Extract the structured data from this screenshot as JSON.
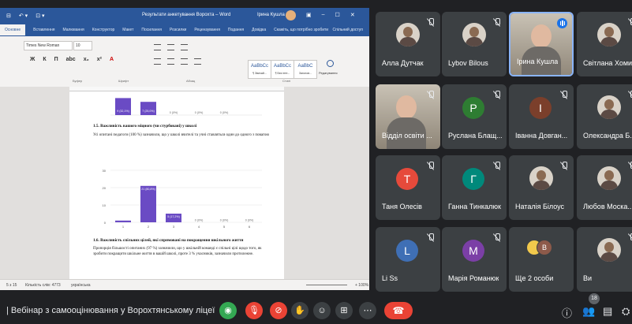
{
  "word": {
    "quick_access": [
      "⊟",
      "↶ ▾",
      "⊡ ▾"
    ],
    "doc_title": "Результати анкетування Ворохта – Word",
    "user_name": "Ірина Кушла",
    "window_controls": [
      "▣",
      "–",
      "☐",
      "✕"
    ],
    "tabs": [
      "Основне",
      "Вставлення",
      "Малювання",
      "Конструктор",
      "Макет",
      "Посилання",
      "Розсилки",
      "Рецензування",
      "Подання",
      "Довідка"
    ],
    "tell_me": "Скажіть, що потрібно зробити",
    "share_label": "Спільний доступ",
    "font_name": "Times New Roman",
    "font_size": "10",
    "format_buttons": [
      "Ж",
      "К",
      "П",
      "abc",
      "x₂",
      "x²",
      "A"
    ],
    "style_samples": [
      "AaBbCc",
      "AaBbCc",
      "AaBbC"
    ],
    "style_names": [
      "¶ Звичай...",
      "¶ Без інте...",
      "Заголов..."
    ],
    "edit_label": "Редагування",
    "groups": [
      "Буфер",
      "Шрифт",
      "Абзац",
      "Стилі"
    ],
    "section_heading": "1.5. Важливість вашого міцного (чи стурбовані) у школі",
    "paragraph1": "Усі опитані педагоги (100 %) зазначили, що у школі вчителі та учні ставляться один до одного з повагою",
    "heading2": "1.6. Важливість спільних цілей, які спрямовані на покращення шкільного життя",
    "paragraph2": "Пропорція більшості опитаних (97 %) зазначили, що у шкільній команді є спільні цілі щодо того, як зробити покращити шкільне життя в вашій школі, проте 3 % учасників, зазначили протилежне.",
    "top_bar_labels": [
      "9 (32,1%)",
      "7 (25,0%)",
      "0 (0%)",
      "0 (0%)",
      "0 (0%)"
    ],
    "y_ticks": [
      "30",
      "20",
      "10",
      "0"
    ],
    "chart_bar_labels": [
      "1 (3,4%)",
      "21 (80,8%)",
      "5 (17,2%)",
      "0 (0%)",
      "0 (0%)",
      "0 (0%)"
    ],
    "x_ticks": [
      "1",
      "2",
      "3",
      "4",
      "5",
      "6"
    ],
    "status": {
      "page": "5 з 15",
      "words": "Кількість слів: 4773",
      "lang": "українська",
      "zoom": "+ 100%"
    }
  },
  "chart_data": {
    "type": "bar",
    "categories": [
      "1",
      "2",
      "3",
      "4",
      "5",
      "6"
    ],
    "values": [
      1,
      21,
      5,
      0,
      0,
      0
    ],
    "data_labels": [
      "1 (3,4%)",
      "21 (80,8%)",
      "5 (17,2%)",
      "0 (0%)",
      "0 (0%)",
      "0 (0%)"
    ],
    "ylim": [
      0,
      30
    ],
    "y_ticks": [
      0,
      10,
      20,
      30
    ],
    "bar_color": "#6a4bc4",
    "grid": true
  },
  "partial_chart": {
    "values": [
      9,
      7,
      0,
      0,
      0
    ]
  },
  "participants": [
    {
      "name": "Алла Дутчак",
      "kind": "photo",
      "muted": true
    },
    {
      "name": "Lybov Bilous",
      "kind": "photo",
      "muted": true
    },
    {
      "name": "Ірина Кушла",
      "kind": "video",
      "muted": false
    },
    {
      "name": "Світлана Хомин",
      "kind": "photo",
      "muted": true
    },
    {
      "name": "Відділ освіти ...",
      "kind": "video",
      "muted": true
    },
    {
      "name": "Руслана Блащ...",
      "kind": "letter",
      "letter": "Р",
      "color": "#2e7d32",
      "muted": true
    },
    {
      "name": "Іванна Довган...",
      "kind": "letter",
      "letter": "І",
      "color": "#7b3f2b",
      "muted": true
    },
    {
      "name": "Олександра Б...",
      "kind": "photo",
      "muted": true
    },
    {
      "name": "Таня Олесів",
      "kind": "letter",
      "letter": "Т",
      "color": "#e64a3b",
      "muted": true
    },
    {
      "name": "Ганна Тинкалюк",
      "kind": "letter",
      "letter": "Г",
      "color": "#00897b",
      "muted": true
    },
    {
      "name": "Наталія Білоус",
      "kind": "photo",
      "muted": true
    },
    {
      "name": "Любов Моска...",
      "kind": "photo",
      "muted": true
    },
    {
      "name": "Li Ss",
      "kind": "letter",
      "letter": "L",
      "color": "#3f6fb5",
      "muted": true
    },
    {
      "name": "Марія Романюк",
      "kind": "letter",
      "letter": "M",
      "color": "#7b3fa6",
      "muted": true
    },
    {
      "name": "Ще 2 особи",
      "kind": "group",
      "muted": false,
      "group_letter": "B"
    },
    {
      "name": "Ви",
      "kind": "photo",
      "muted": true
    }
  ],
  "bottom": {
    "meeting_title": "| Вебінар з самооцінювання у Ворохтянському ліцеї",
    "participant_count": "18",
    "more_label": "⋯"
  },
  "colors": {
    "call_bg": "#202124",
    "tile_bg": "#3c4043",
    "danger": "#ea4335",
    "word_blue": "#2b579a",
    "speaking": "#1a73e8"
  }
}
